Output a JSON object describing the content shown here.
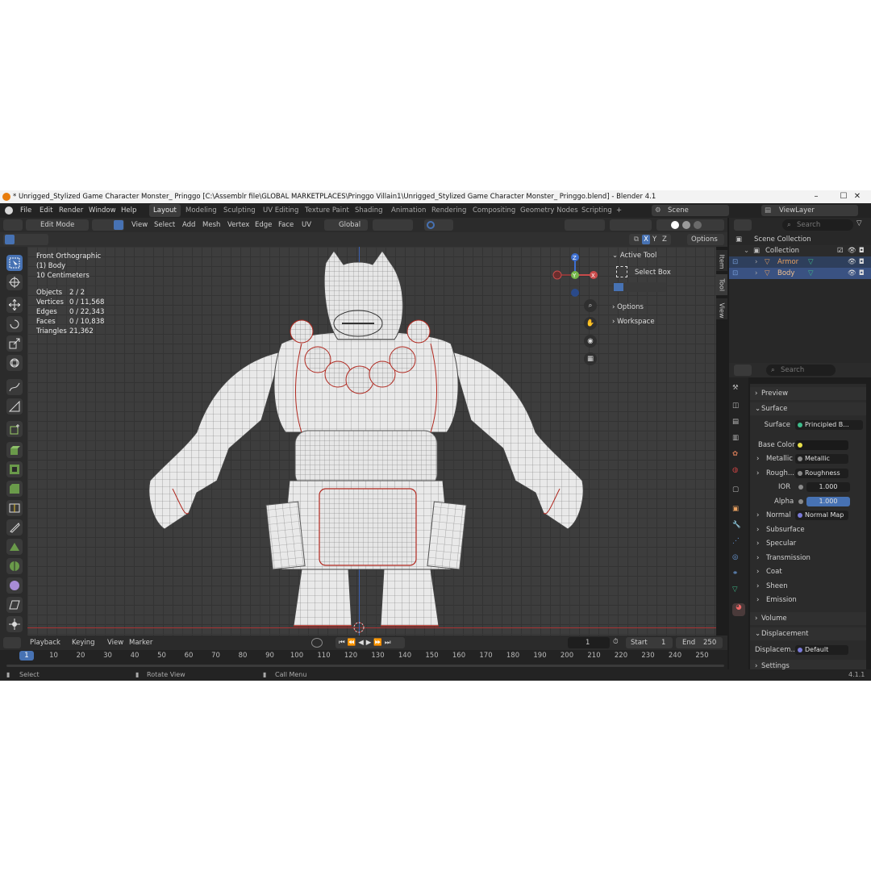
{
  "window": {
    "title": "* Unrigged_Stylized Game Character Monster_ Pringgo [C:\\Assemblr file\\GLOBAL MARKETPLACES\\Pringgo Villain1\\Unrigged_Stylized Game Character Monster_ Pringgo.blend] - Blender 4.1",
    "minimize": "–",
    "maximize": "☐",
    "close": "✕"
  },
  "menu": [
    "File",
    "Edit",
    "Render",
    "Window",
    "Help"
  ],
  "workspaces": [
    {
      "label": "Layout",
      "active": true
    },
    {
      "label": "Modeling",
      "active": false
    },
    {
      "label": "Sculpting",
      "active": false
    },
    {
      "label": "UV Editing",
      "active": false
    },
    {
      "label": "Texture Paint",
      "active": false
    },
    {
      "label": "Shading",
      "active": false
    },
    {
      "label": "Animation",
      "active": false
    },
    {
      "label": "Rendering",
      "active": false
    },
    {
      "label": "Compositing",
      "active": false
    },
    {
      "label": "Geometry Nodes",
      "active": false
    },
    {
      "label": "Scripting",
      "active": false
    }
  ],
  "add_workspace": "+",
  "scene": {
    "label": "Scene",
    "view_layer": "ViewLayer"
  },
  "viewport_header": {
    "mode": "Edit Mode",
    "menus": [
      "View",
      "Select",
      "Add",
      "Mesh",
      "Vertex",
      "Edge",
      "Face",
      "UV"
    ],
    "orientation": "Global",
    "axes": [
      "X",
      "Y",
      "Z"
    ],
    "options": "Options"
  },
  "viewport_info": {
    "view": "Front Orthographic",
    "object": "(1) Body",
    "scale": "10 Centimeters",
    "stats": [
      {
        "label": "Objects",
        "value": "2 / 2"
      },
      {
        "label": "Vertices",
        "value": "0 / 11,568"
      },
      {
        "label": "Edges",
        "value": "0 / 22,343"
      },
      {
        "label": "Faces",
        "value": "0 / 10,838"
      },
      {
        "label": "Triangles",
        "value": "21,362"
      }
    ]
  },
  "gizmo": {
    "x": "X",
    "y": "Y",
    "z": "Z"
  },
  "n_panel": {
    "active_tool": "Active Tool",
    "select_box": "Select Box",
    "options": "Options",
    "workspace": "Workspace",
    "tabs": [
      "Item",
      "Tool",
      "View"
    ]
  },
  "outliner": {
    "search_placeholder": "Search",
    "scene_collection": "Scene Collection",
    "collection": "Collection",
    "objects": [
      "Armor",
      "Body"
    ]
  },
  "properties": {
    "search_placeholder": "Search",
    "preview": "Preview",
    "surface_section": "Surface",
    "surface_label": "Surface",
    "surface_value": "Principled B...",
    "base_color": "Base Color",
    "metallic_label": "Metallic",
    "metallic_value": "Metallic",
    "roughness_label": "Rough...",
    "roughness_value": "Roughness",
    "ior_label": "IOR",
    "ior_value": "1.000",
    "alpha_label": "Alpha",
    "alpha_value": "1.000",
    "normal_label": "Normal",
    "normal_value": "Normal Map",
    "subsurface": "Subsurface",
    "specular": "Specular",
    "transmission": "Transmission",
    "coat": "Coat",
    "sheen": "Sheen",
    "emission": "Emission",
    "volume": "Volume",
    "displacement": "Displacement",
    "displacement_label": "Displacem...",
    "displacement_value": "Default",
    "settings": "Settings"
  },
  "timeline": {
    "menus": [
      "Playback",
      "Keying",
      "View",
      "Marker"
    ],
    "current_frame": "1",
    "start_label": "Start",
    "start_value": "1",
    "end_label": "End",
    "end_value": "250",
    "ticks": [
      "1",
      "10",
      "20",
      "30",
      "40",
      "50",
      "60",
      "70",
      "80",
      "90",
      "100",
      "110",
      "120",
      "130",
      "140",
      "150",
      "160",
      "170",
      "180",
      "190",
      "200",
      "210",
      "220",
      "230",
      "240",
      "250"
    ]
  },
  "status": {
    "select": "Select",
    "rotate": "Rotate View",
    "menu": "Call Menu",
    "version": "4.1.1"
  },
  "colors": {
    "accent": "#4772b3",
    "orange": "#e87d0d",
    "x_axis": "#c94b4b",
    "y_axis": "#75b64a",
    "z_axis": "#3d6fd1"
  }
}
